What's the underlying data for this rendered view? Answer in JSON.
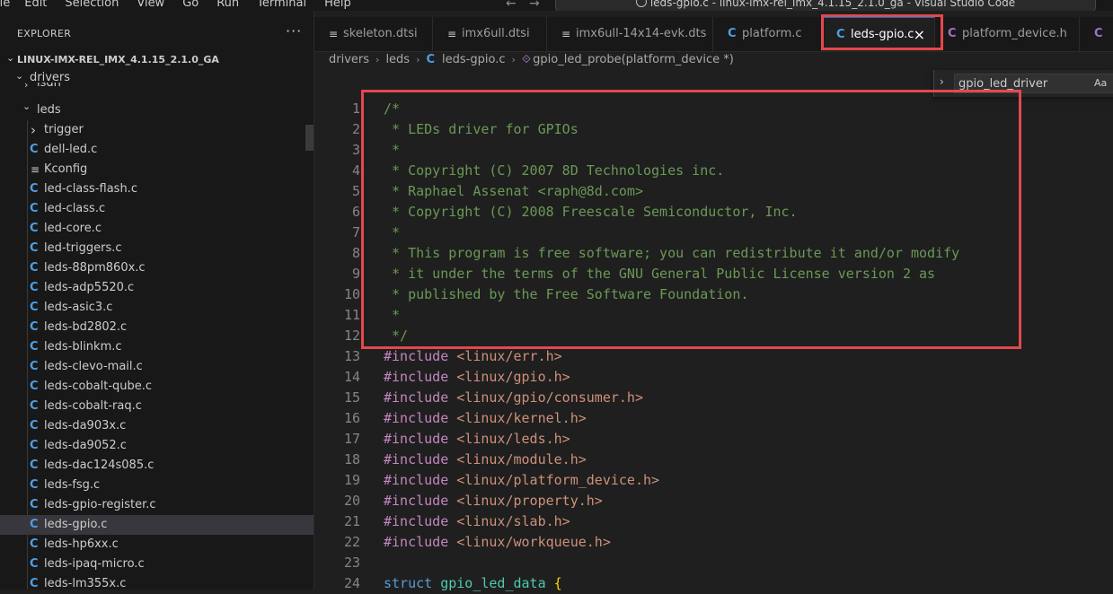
{
  "menubar": [
    "ile",
    "Edit",
    "Selection",
    "View",
    "Go",
    "Run",
    "Terminal",
    "Help"
  ],
  "window_title": "leds-gpio.c - linux-imx-rel_imx_4.1.15_2.1.0_ga - Visual Studio Code",
  "sidebar": {
    "header": "EXPLORER",
    "more": "···",
    "workspace": "LINUX-IMX-REL_IMX_4.1.15_2.1.0_GA",
    "drivers": "drivers",
    "isdn": "isdn",
    "leds": "leds",
    "trigger": "trigger",
    "files": [
      {
        "name": "dell-led.c",
        "type": "c"
      },
      {
        "name": "Kconfig",
        "type": "kconfig"
      },
      {
        "name": "led-class-flash.c",
        "type": "c"
      },
      {
        "name": "led-class.c",
        "type": "c"
      },
      {
        "name": "led-core.c",
        "type": "c"
      },
      {
        "name": "led-triggers.c",
        "type": "c"
      },
      {
        "name": "leds-88pm860x.c",
        "type": "c"
      },
      {
        "name": "leds-adp5520.c",
        "type": "c"
      },
      {
        "name": "leds-asic3.c",
        "type": "c"
      },
      {
        "name": "leds-bd2802.c",
        "type": "c"
      },
      {
        "name": "leds-blinkm.c",
        "type": "c"
      },
      {
        "name": "leds-clevo-mail.c",
        "type": "c"
      },
      {
        "name": "leds-cobalt-qube.c",
        "type": "c"
      },
      {
        "name": "leds-cobalt-raq.c",
        "type": "c"
      },
      {
        "name": "leds-da903x.c",
        "type": "c"
      },
      {
        "name": "leds-da9052.c",
        "type": "c"
      },
      {
        "name": "leds-dac124s085.c",
        "type": "c"
      },
      {
        "name": "leds-fsg.c",
        "type": "c"
      },
      {
        "name": "leds-gpio-register.c",
        "type": "c"
      },
      {
        "name": "leds-gpio.c",
        "type": "c",
        "selected": true
      },
      {
        "name": "leds-hp6xx.c",
        "type": "c"
      },
      {
        "name": "leds-ipaq-micro.c",
        "type": "c"
      },
      {
        "name": "leds-lm355x.c",
        "type": "c"
      }
    ]
  },
  "tabs": [
    {
      "label": "skeleton.dtsi",
      "icon": "lines"
    },
    {
      "label": "imx6ull.dtsi",
      "icon": "lines"
    },
    {
      "label": "imx6ull-14x14-evk.dts",
      "icon": "lines"
    },
    {
      "label": "platform.c",
      "icon": "c"
    },
    {
      "label": "leds-gpio.c",
      "icon": "c",
      "active": true
    },
    {
      "label": "platform_device.h",
      "icon": "h"
    },
    {
      "label": "",
      "icon": "h"
    }
  ],
  "tab_close": "×",
  "breadcrumb": {
    "items": [
      "drivers",
      "leds",
      "leds-gpio.c",
      "gpio_led_probe(platform_device *)"
    ]
  },
  "find": {
    "value": "gpio_led_driver",
    "case_label": "Aa"
  },
  "editor": {
    "lines": [
      {
        "n": "1",
        "text": "/*"
      },
      {
        "n": "2",
        "text": " * LEDs driver for GPIOs"
      },
      {
        "n": "3",
        "text": " *"
      },
      {
        "n": "4",
        "text": " * Copyright (C) 2007 8D Technologies inc."
      },
      {
        "n": "5",
        "text": " * Raphael Assenat <raph@8d.com>"
      },
      {
        "n": "6",
        "text": " * Copyright (C) 2008 Freescale Semiconductor, Inc."
      },
      {
        "n": "7",
        "text": " *"
      },
      {
        "n": "8",
        "text": " * This program is free software; you can redistribute it and/or modify"
      },
      {
        "n": "9",
        "text": " * it under the terms of the GNU General Public License version 2 as"
      },
      {
        "n": "10",
        "text": " * published by the Free Software Foundation."
      },
      {
        "n": "11",
        "text": " *"
      },
      {
        "n": "12",
        "text": " */"
      },
      {
        "n": "13",
        "directive": "#include",
        "header": "<linux/err.h>"
      },
      {
        "n": "14",
        "directive": "#include",
        "header": "<linux/gpio.h>"
      },
      {
        "n": "15",
        "directive": "#include",
        "header": "<linux/gpio/consumer.h>"
      },
      {
        "n": "16",
        "directive": "#include",
        "header": "<linux/kernel.h>"
      },
      {
        "n": "17",
        "directive": "#include",
        "header": "<linux/leds.h>"
      },
      {
        "n": "18",
        "directive": "#include",
        "header": "<linux/module.h>"
      },
      {
        "n": "19",
        "directive": "#include",
        "header": "<linux/platform_device.h>"
      },
      {
        "n": "20",
        "directive": "#include",
        "header": "<linux/property.h>"
      },
      {
        "n": "21",
        "directive": "#include",
        "header": "<linux/slab.h>"
      },
      {
        "n": "22",
        "directive": "#include",
        "header": "<linux/workqueue.h>"
      },
      {
        "n": "23",
        "text": ""
      },
      {
        "n": "24",
        "kw": "struct",
        "name": "gpio_led_data",
        "brace": "{"
      }
    ]
  },
  "colors": {
    "annotation": "#e5484d",
    "comment": "#6a9955",
    "directive": "#c586c0",
    "string": "#ce9178",
    "keyword": "#569cd6",
    "type": "#4ec9b0"
  }
}
